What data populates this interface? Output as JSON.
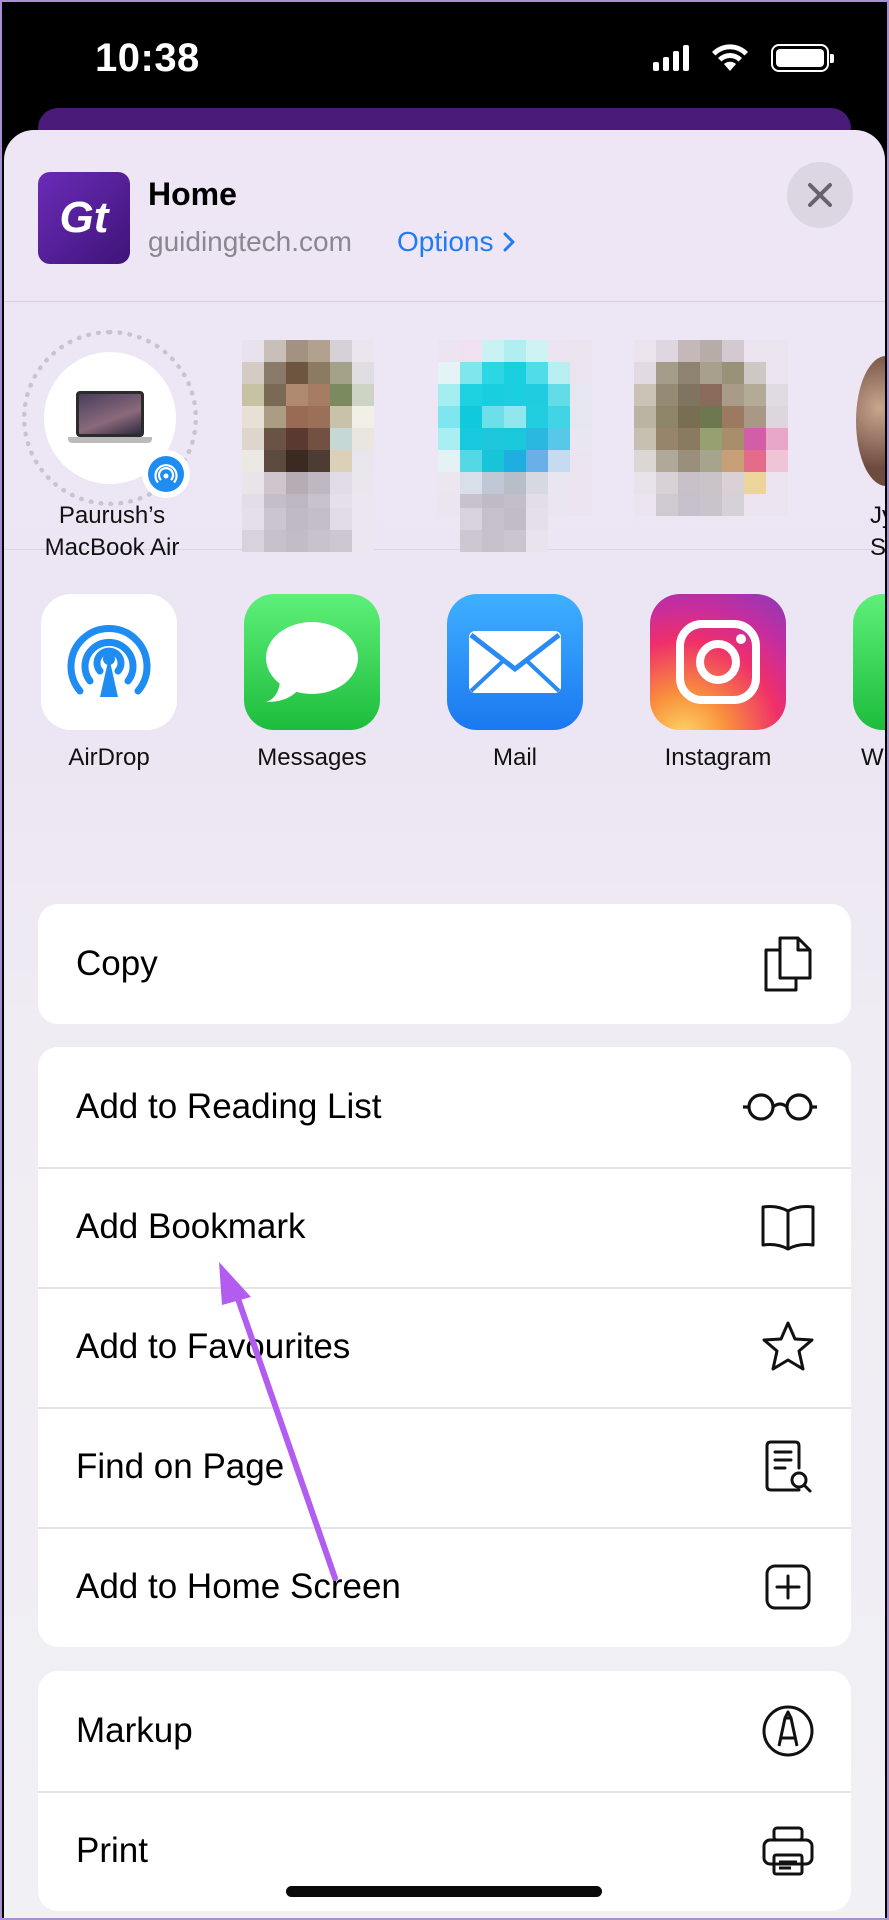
{
  "status_bar": {
    "time": "10:38"
  },
  "header": {
    "title": "Home",
    "domain": "guidingtech.com",
    "options_label": "Options",
    "logo_text": "Gt"
  },
  "people": [
    {
      "label_line1": "Paurush’s",
      "label_line2": "MacBook Air"
    },
    {
      "label_line1": "Jy",
      "label_line2": "Si"
    }
  ],
  "apps": [
    {
      "label": "AirDrop",
      "icon": "airdrop-icon",
      "color": "#ffffff"
    },
    {
      "label": "Messages",
      "icon": "messages-icon",
      "color": "#2dc94e"
    },
    {
      "label": "Mail",
      "icon": "mail-icon",
      "color": "#2394f5"
    },
    {
      "label": "Instagram",
      "icon": "instagram-icon",
      "color": "#e1306c"
    },
    {
      "label": "Wh",
      "icon": "whatsapp-icon",
      "color": "#25d366"
    }
  ],
  "actions": {
    "group1": [
      {
        "label": "Copy",
        "icon": "copy-icon"
      }
    ],
    "group2": [
      {
        "label": "Add to Reading List",
        "icon": "glasses-icon"
      },
      {
        "label": "Add Bookmark",
        "icon": "book-icon"
      },
      {
        "label": "Add to Favourites",
        "icon": "star-icon"
      },
      {
        "label": "Find on Page",
        "icon": "find-document-icon"
      },
      {
        "label": "Add to Home Screen",
        "icon": "plus-square-icon"
      }
    ],
    "group3": [
      {
        "label": "Markup",
        "icon": "markup-pen-icon"
      },
      {
        "label": "Print",
        "icon": "printer-icon"
      }
    ]
  },
  "colors": {
    "accent": "#1f7cf6",
    "annotation_arrow": "#b25cf0"
  }
}
